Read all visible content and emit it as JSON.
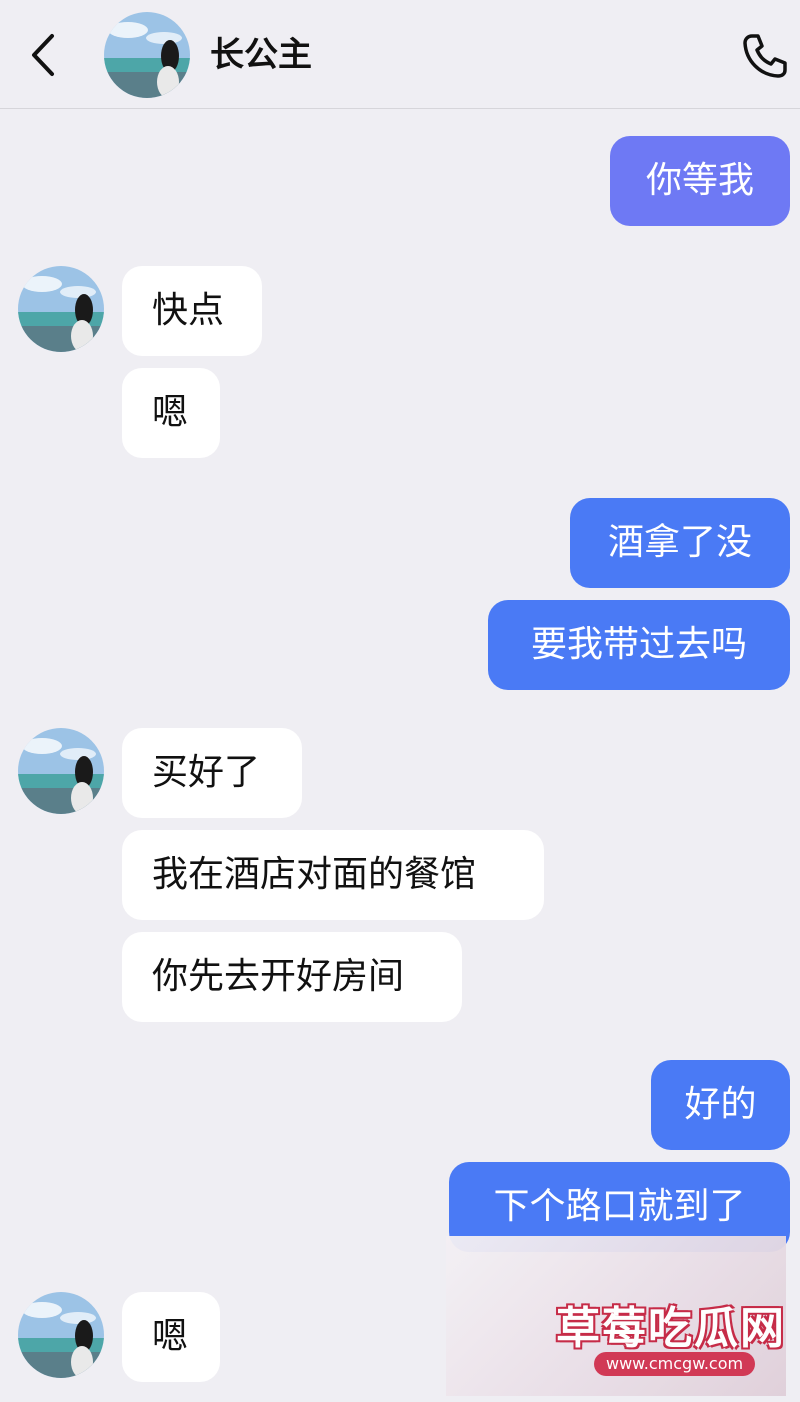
{
  "header": {
    "title": "长公主",
    "back_icon": "chevron-left-icon",
    "call_icon": "phone-icon"
  },
  "colors": {
    "background": "#efeef3",
    "outgoing_light": "#6e79f4",
    "outgoing": "#4a7af5",
    "incoming": "#ffffff"
  },
  "messages": [
    {
      "sender": "me",
      "text": "你等我"
    },
    {
      "sender": "contact",
      "text": "快点"
    },
    {
      "sender": "contact",
      "text": "嗯"
    },
    {
      "sender": "me",
      "text": "酒拿了没"
    },
    {
      "sender": "me",
      "text": "要我带过去吗"
    },
    {
      "sender": "contact",
      "text": "买好了"
    },
    {
      "sender": "contact",
      "text": "我在酒店对面的餐馆"
    },
    {
      "sender": "contact",
      "text": "你先去开好房间"
    },
    {
      "sender": "me",
      "text": "好的"
    },
    {
      "sender": "me",
      "text": "下个路口就到了"
    },
    {
      "sender": "contact",
      "text": "嗯"
    }
  ],
  "watermark": {
    "title": "草莓吃瓜网",
    "url": "www.cmcgw.com"
  }
}
